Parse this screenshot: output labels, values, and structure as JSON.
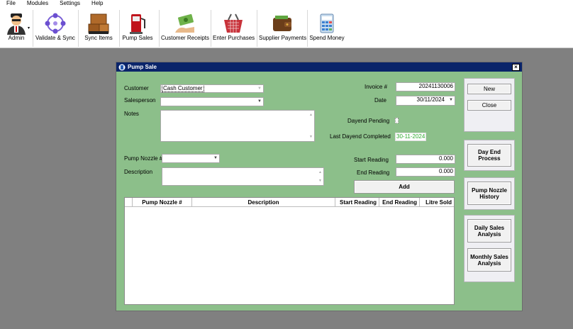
{
  "menu": [
    "File",
    "Modules",
    "Settings",
    "Help"
  ],
  "toolbar": {
    "admin": "Admin",
    "validate_sync": "Validate & Sync",
    "sync_items": "Sync Items",
    "pump_sales": "Pump Sales",
    "customer_receipts": "Customer Receipts",
    "enter_purchases": "Enter Purchases",
    "supplier_payments": "Supplier Payments",
    "spend_money": "Spend Money"
  },
  "dialog": {
    "title": "Pump Sale",
    "close": "×",
    "customer_label": "Customer",
    "customer_value": "Cash Customer",
    "salesperson_label": "Salesperson",
    "salesperson_value": "",
    "notes_label": "Notes",
    "invoice_label": "Invoice #",
    "invoice_value": "20241130006",
    "date_label": "Date",
    "date_value": "30/11/2024",
    "dayend_pending_label": "Dayend Pending",
    "last_dayend_label": "Last Dayend Completed",
    "last_dayend_value": "30-11-2024",
    "pump_nozzle_label": "Pump Nozzle #",
    "description_label": "Description",
    "start_reading_label": "Start Reading",
    "start_reading_value": "0.000",
    "end_reading_label": "End Reading",
    "end_reading_value": "0.000",
    "add_button": "Add",
    "buttons": {
      "new": "New",
      "close": "Close",
      "day_end": "Day End Process",
      "pump_history": "Pump Nozzle History",
      "daily_sales": "Daily Sales Analysis",
      "monthly_sales": "Monthly Sales Analysis"
    },
    "grid_columns": [
      "Pump Nozzle #",
      "Description",
      "Start Reading",
      "End Reading",
      "Litre Sold"
    ]
  }
}
